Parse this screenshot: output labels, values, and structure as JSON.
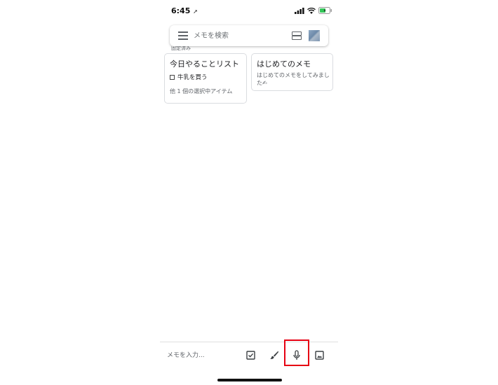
{
  "status_bar": {
    "time": "6:45"
  },
  "search": {
    "placeholder": "メモを検索"
  },
  "pinned_section": {
    "label": "固定済み"
  },
  "notes": [
    {
      "title": "今日やることリスト",
      "checklist": [
        {
          "label": "牛乳を買う",
          "checked": false
        }
      ],
      "more_items": "他 1 個の選択中アイテム"
    },
    {
      "title": "はじめてのメモ",
      "body": "はじめてのメモをしてみました✍"
    }
  ],
  "bottom_bar": {
    "input_placeholder": "メモを入力...",
    "tools": [
      {
        "name": "new-list",
        "icon": "checkbox-icon"
      },
      {
        "name": "new-drawing",
        "icon": "brush-icon"
      },
      {
        "name": "voice-note",
        "icon": "mic-icon",
        "highlighted": true
      },
      {
        "name": "image-note",
        "icon": "image-icon"
      }
    ]
  },
  "colors": {
    "highlight": "#e60012",
    "battery": "#34c759",
    "text": "#202124",
    "secondary": "#5f6368"
  }
}
